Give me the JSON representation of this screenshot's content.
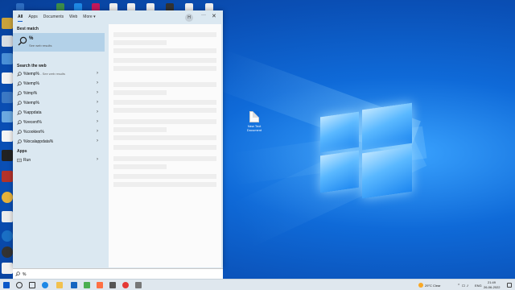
{
  "search_panel": {
    "tabs": [
      {
        "label": "All",
        "active": true
      },
      {
        "label": "Apps"
      },
      {
        "label": "Documents"
      },
      {
        "label": "Web"
      },
      {
        "label": "More ▾"
      }
    ],
    "avatar_initial": "H",
    "more_icon": "···",
    "close_icon": "✕",
    "best_match": {
      "section": "Best match",
      "title": "%",
      "subtitle": "See web results"
    },
    "web_section": "Search the web",
    "web_results": [
      {
        "text": "%temp%",
        "suffix": " - See web results"
      },
      {
        "text": "%temp%"
      },
      {
        "text": "%tmp%"
      },
      {
        "text": "%temp%"
      },
      {
        "text": "%appdata"
      },
      {
        "text": "%recent%"
      },
      {
        "text": "%cookies%"
      },
      {
        "text": "%localappdata%"
      }
    ],
    "apps_section": "Apps",
    "apps": [
      {
        "text": "Run"
      }
    ],
    "chevron": "›"
  },
  "searchbox": {
    "value": "%",
    "icon": "search-icon"
  },
  "taskbar": {
    "weather": "29°C  Clear",
    "time": "21:49",
    "date": "26-06-2022",
    "lang": "ENG"
  },
  "desktop": {
    "file_label": "New Text Document"
  },
  "colors": {
    "accent": "#0a58c8",
    "panel_bg": "#dbe8f1",
    "best_match_bg": "#b3d1e8",
    "wallpaper": "#0f6ad8"
  }
}
